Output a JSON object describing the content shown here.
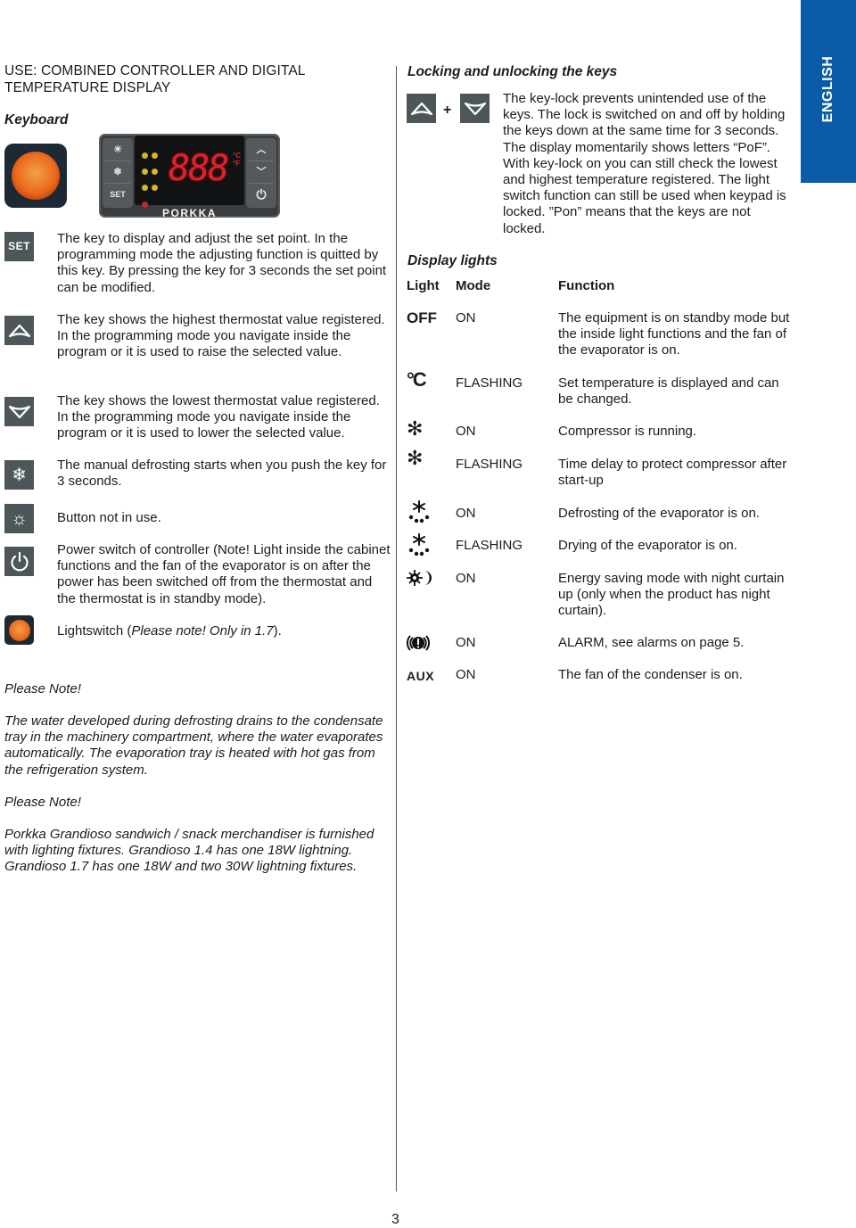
{
  "language_tab": "ENGLISH",
  "left": {
    "title_line1": "USE: COMBINED CONTROLLER AND DIGITAL",
    "title_line2": "TEMPERATURE DISPLAY",
    "keyboard_heading": "Keyboard",
    "controller": {
      "display_digits": "888",
      "unit_c": "°C",
      "unit_f": "°F",
      "brand": "PORKKA",
      "set_label": "SET"
    },
    "keys": [
      {
        "icon": "set-key-icon",
        "label": "SET",
        "text": "The key to display and adjust the set point. In the programming mode the adjusting function is quitted by this key. By pressing the key for 3 seconds the set point can be modified."
      },
      {
        "icon": "up-arrow-key-icon",
        "text": "The key shows the highest thermostat value registered. In the programming mode you navigate inside the program or it is used to raise the selected value."
      },
      {
        "icon": "down-arrow-key-icon",
        "text": "The key shows the lowest thermostat value registered. In the programming mode you navigate inside the program or it is used to lower the selected value."
      },
      {
        "icon": "defrost-key-icon",
        "text": "The manual defrosting starts when you push the key for 3 seconds."
      },
      {
        "icon": "light-key-icon",
        "text": "Button not in use."
      },
      {
        "icon": "power-key-icon",
        "text": "Power switch of controller (Note! Light inside the cabinet functions and the fan of the evaporator is on after the power has been switched off from the thermostat and the thermostat is in standby mode)."
      },
      {
        "icon": "lightswitch-icon",
        "text_prefix": "Lightswitch (",
        "text_italic": "Please note! Only in 1.7",
        "text_suffix": ")."
      }
    ],
    "note1_heading": "Please Note!",
    "note1_text": "The water developed during defrosting drains to the condensate tray in the machinery compartment, where the water evaporates automatically. The evaporation tray is heated with hot gas from the refrigeration system.",
    "note2_heading": "Please Note!",
    "note2_text": "Porkka Grandioso sandwich / snack merchandiser is furnished with lighting fixtures. Grandioso 1.4 has one 18W lightning. Grandioso 1.7 has one 18W and two 30W lightning fixtures."
  },
  "right": {
    "lock_heading": "Locking and unlocking the keys",
    "lock_plus": "+",
    "lock_text": "The key-lock prevents unintended use of the keys. The lock is switched on and off by holding the keys down at the same time for 3 seconds. The display momentarily shows letters “PoF”. With key-lock on you can still check the lowest and highest temperature registered. The light switch function can still be used when keypad is locked. ”Pon” means that the keys are not locked.",
    "display_heading": "Display lights",
    "columns": {
      "light": "Light",
      "mode": "Mode",
      "function": "Function"
    },
    "rows": [
      {
        "light": "OFF",
        "icon": "off-text",
        "mode": "ON",
        "function": "The equipment is on standby mode but the inside light functions and the fan of the evaporator is on."
      },
      {
        "light": "°C",
        "icon": "celsius-icon",
        "mode": "FLASHING",
        "function": "Set temperature is displayed and can be changed."
      },
      {
        "light": "❄",
        "icon": "compressor-icon",
        "mode": "ON",
        "function": "Compressor is running."
      },
      {
        "light": "❄",
        "icon": "compressor-icon",
        "mode": "FLASHING",
        "function": "Time delay to protect compressor after start-up"
      },
      {
        "light": "defrost",
        "icon": "defrost-icon",
        "mode": "ON",
        "function": "Defrosting of the evaporator is on."
      },
      {
        "light": "defrost",
        "icon": "defrost-icon",
        "mode": "FLASHING",
        "function": "Drying of the evaporator is on."
      },
      {
        "light": "energy",
        "icon": "energy-saving-icon",
        "mode": "ON",
        "function": "Energy saving mode with night curtain up (only when the product has night curtain)."
      },
      {
        "light": "alarm",
        "icon": "alarm-icon",
        "mode": "ON",
        "function": "ALARM, see alarms on page 5."
      },
      {
        "light": "AUX",
        "icon": "aux-text",
        "mode": "ON",
        "function": "The fan of the condenser is on."
      }
    ]
  },
  "page_number": "3"
}
